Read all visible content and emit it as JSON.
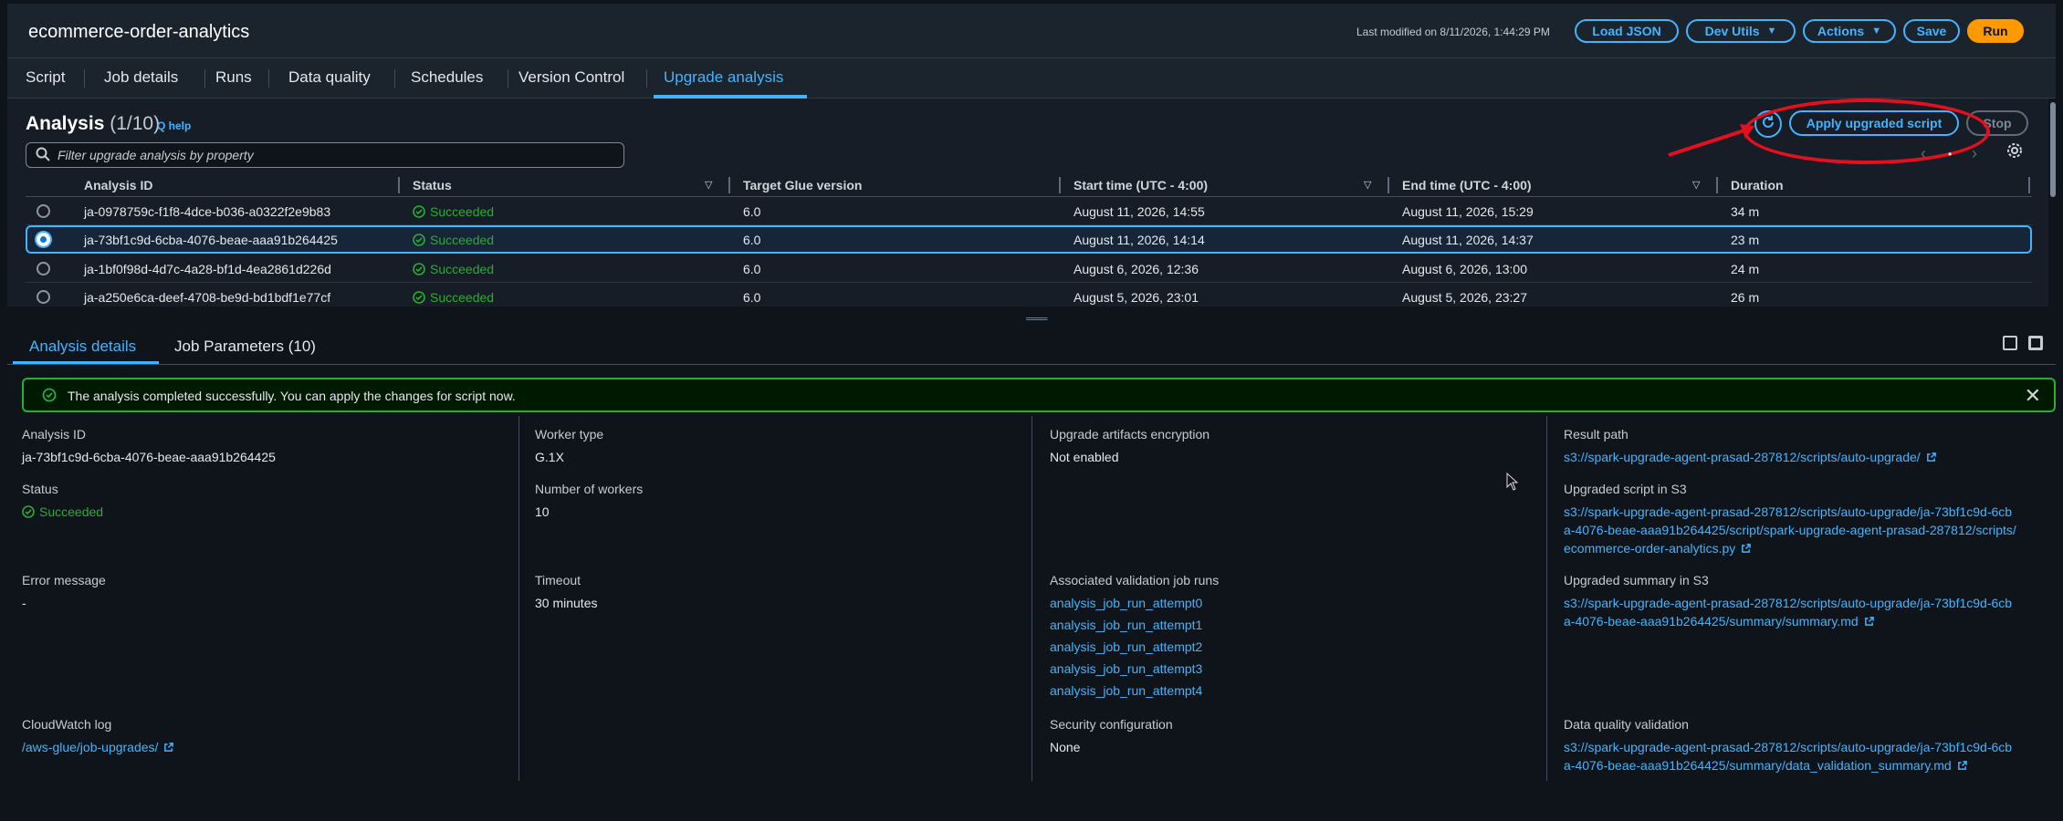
{
  "header": {
    "title": "ecommerce-order-analytics",
    "last_modified": "Last modified on 8/11/2026, 1:44:29 PM",
    "buttons": {
      "load_json": "Load JSON",
      "dev_utils": "Dev Utils",
      "actions": "Actions",
      "save": "Save",
      "run": "Run"
    }
  },
  "tabs": [
    "Script",
    "Job details",
    "Runs",
    "Data quality",
    "Schedules",
    "Version Control",
    "Upgrade analysis"
  ],
  "active_tab": "Upgrade analysis",
  "analysis": {
    "title": "Analysis",
    "count": "(1/10)",
    "help": "Q help",
    "filter_placeholder": "Filter upgrade analysis by property",
    "apply_button": "Apply upgraded script",
    "stop_button": "Stop",
    "columns": [
      "Analysis ID",
      "Status",
      "Target Glue version",
      "Start time (UTC - 4:00)",
      "End time (UTC - 4:00)",
      "Duration"
    ],
    "rows": [
      {
        "id": "ja-0978759c-f1f8-4dce-b036-a0322f2e9b83",
        "status": "Succeeded",
        "version": "6.0",
        "start": "August 11, 2026, 14:55",
        "end": "August 11, 2026, 15:29",
        "duration": "34 m",
        "selected": false
      },
      {
        "id": "ja-73bf1c9d-6cba-4076-beae-aaa91b264425",
        "status": "Succeeded",
        "version": "6.0",
        "start": "August 11, 2026, 14:14",
        "end": "August 11, 2026, 14:37",
        "duration": "23 m",
        "selected": true
      },
      {
        "id": "ja-1bf0f98d-4d7c-4a28-bf1d-4ea2861d226d",
        "status": "Succeeded",
        "version": "6.0",
        "start": "August 6, 2026, 12:36",
        "end": "August 6, 2026, 13:00",
        "duration": "24 m",
        "selected": false
      },
      {
        "id": "ja-a250e6ca-deef-4708-be9d-bd1bdf1e77cf",
        "status": "Succeeded",
        "version": "6.0",
        "start": "August 5, 2026, 23:01",
        "end": "August 5, 2026, 23:27",
        "duration": "26 m",
        "selected": false
      }
    ]
  },
  "details": {
    "tabs": [
      "Analysis details",
      "Job Parameters (10)"
    ],
    "alert": "The analysis completed successfully. You can apply the changes for script now.",
    "analysis_id_label": "Analysis ID",
    "analysis_id": "ja-73bf1c9d-6cba-4076-beae-aaa91b264425",
    "status_label": "Status",
    "status": "Succeeded",
    "error_label": "Error message",
    "error": "-",
    "cloudwatch_label": "CloudWatch log",
    "cloudwatch": "/aws-glue/job-upgrades/",
    "worker_type_label": "Worker type",
    "worker_type": "G.1X",
    "num_workers_label": "Number of workers",
    "num_workers": "10",
    "timeout_label": "Timeout",
    "timeout": "30 minutes",
    "encryption_label": "Upgrade artifacts encryption",
    "encryption": "Not enabled",
    "validation_runs_label": "Associated validation job runs",
    "validation_runs": [
      "analysis_job_run_attempt0",
      "analysis_job_run_attempt1",
      "analysis_job_run_attempt2",
      "analysis_job_run_attempt3",
      "analysis_job_run_attempt4"
    ],
    "security_label": "Security configuration",
    "security": "None",
    "result_path_label": "Result path",
    "result_path": "s3://spark-upgrade-agent-prasad-287812/scripts/auto-upgrade/",
    "upgraded_script_label": "Upgraded script in S3",
    "upgraded_script": [
      "s3://spark-upgrade-agent-prasad-287812/scripts/auto-upgrade/ja-73bf1c9d-6cb",
      "a-4076-beae-aaa91b264425/script/spark-upgrade-agent-prasad-287812/scripts/",
      "ecommerce-order-analytics.py"
    ],
    "upgraded_summary_label": "Upgraded summary in S3",
    "upgraded_summary": [
      "s3://spark-upgrade-agent-prasad-287812/scripts/auto-upgrade/ja-73bf1c9d-6cb",
      "a-4076-beae-aaa91b264425/summary/summary.md"
    ],
    "dq_label": "Data quality validation",
    "dq": [
      "s3://spark-upgrade-agent-prasad-287812/scripts/auto-upgrade/ja-73bf1c9d-6cb",
      "a-4076-beae-aaa91b264425/summary/data_validation_summary.md"
    ]
  },
  "colors": {
    "accent": "#42b4ff",
    "success": "#29ad32",
    "run": "#ff9900",
    "annotation": "#e3101f"
  }
}
